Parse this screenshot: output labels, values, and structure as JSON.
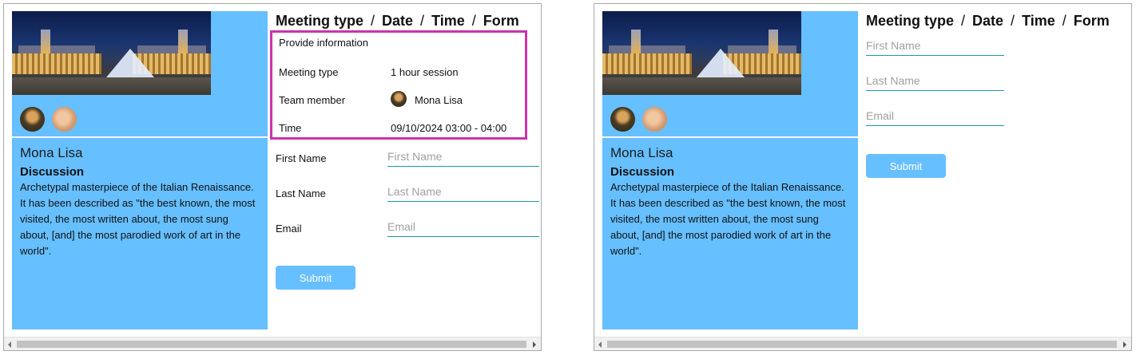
{
  "steps": [
    "Meeting type",
    "Date",
    "Time",
    "Form"
  ],
  "step_separator": "/",
  "member": {
    "name": "Mona Lisa",
    "discussion_title": "Discussion",
    "description": "Archetypal masterpiece of the Italian Renaissance. It has been described as \"the best known, the most visited, the most written about, the most sung about, [and] the most parodied work of art in the world\"."
  },
  "info": {
    "heading": "Provide information",
    "meeting_type_label": "Meeting type",
    "meeting_type_value": "1 hour session",
    "team_member_label": "Team member",
    "team_member_value": "Mona Lisa",
    "time_label": "Time",
    "time_value": "09/10/2024 03:00 - 04:00"
  },
  "form": {
    "first_name_label": "First Name",
    "first_name_placeholder": "First Name",
    "last_name_label": "Last Name",
    "last_name_placeholder": "Last Name",
    "email_label": "Email",
    "email_placeholder": "Email",
    "submit_label": "Submit"
  },
  "colors": {
    "panel": "#66bfff",
    "highlight_border": "#cc33aa",
    "input_underline": "#1b9aaa"
  }
}
